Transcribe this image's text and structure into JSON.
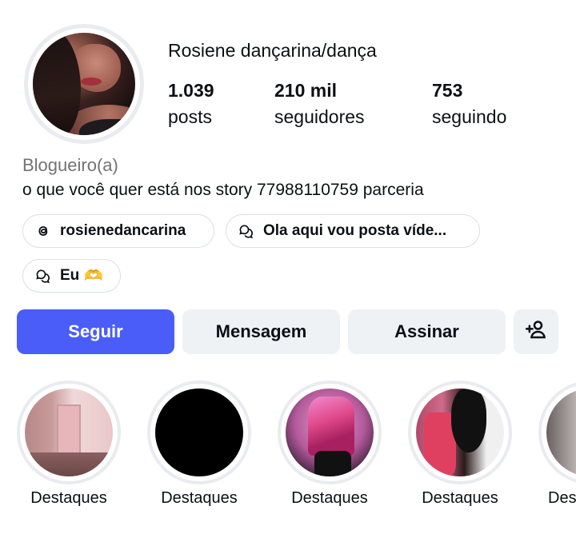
{
  "profile": {
    "name": "Rosiene dançarina/dança",
    "stats": [
      {
        "num": "1.039",
        "label": "posts"
      },
      {
        "num": "210 mil",
        "label": "seguidores"
      },
      {
        "num": "753",
        "label": "seguindo"
      }
    ],
    "category": "Blogueiro(a)",
    "bio": "o que você quer está nos story 77988110759 parceria"
  },
  "chips": {
    "threads": {
      "icon": "threads-icon",
      "label": "rosienedancarina"
    },
    "link1": {
      "icon": "chat-bubbles-icon",
      "label": "Ola aqui vou posta víde..."
    },
    "link2": {
      "icon": "chat-bubbles-icon",
      "label": "Eu",
      "emoji": "🫶"
    }
  },
  "actions": {
    "follow": "Seguir",
    "message": "Mensagem",
    "subscribe": "Assinar",
    "add_user_icon": "add-person-icon"
  },
  "highlights": [
    {
      "label": "Destaques"
    },
    {
      "label": "Destaques"
    },
    {
      "label": "Destaques"
    },
    {
      "label": "Destaques"
    },
    {
      "label": "Des"
    }
  ],
  "colors": {
    "accent": "#4a5df9",
    "button_bg": "#eff2f5",
    "muted_text": "#737373",
    "ring": "#e9ebef"
  }
}
